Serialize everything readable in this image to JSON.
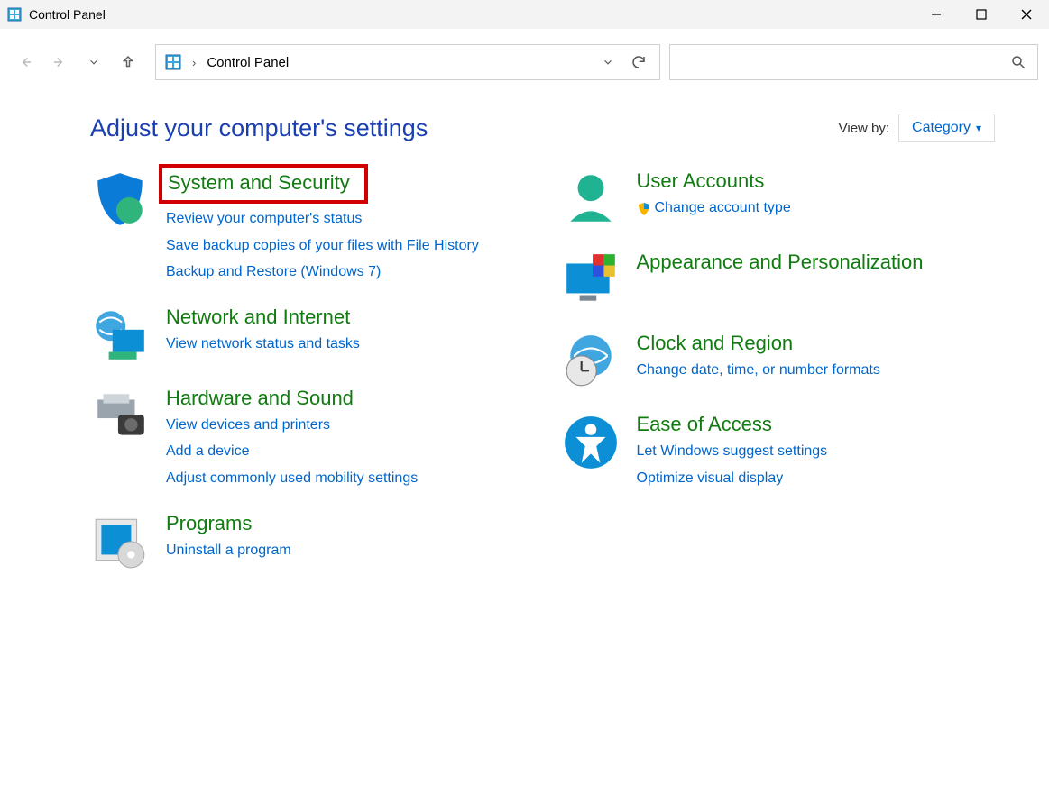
{
  "window": {
    "title": "Control Panel"
  },
  "breadcrumb": {
    "current": "Control Panel"
  },
  "header": {
    "heading": "Adjust your computer's settings",
    "viewby_label": "View by:",
    "viewby_value": "Category"
  },
  "left": [
    {
      "title": "System and Security",
      "highlighted": true,
      "links": [
        "Review your computer's status",
        "Save backup copies of your files with File History",
        "Backup and Restore (Windows 7)"
      ]
    },
    {
      "title": "Network and Internet",
      "links": [
        "View network status and tasks"
      ]
    },
    {
      "title": "Hardware and Sound",
      "links": [
        "View devices and printers",
        "Add a device",
        "Adjust commonly used mobility settings"
      ]
    },
    {
      "title": "Programs",
      "links": [
        "Uninstall a program"
      ]
    }
  ],
  "right": [
    {
      "title": "User Accounts",
      "links": [
        "Change account type"
      ],
      "shield_on_first": true
    },
    {
      "title": "Appearance and Personalization",
      "links": []
    },
    {
      "title": "Clock and Region",
      "links": [
        "Change date, time, or number formats"
      ]
    },
    {
      "title": "Ease of Access",
      "links": [
        "Let Windows suggest settings",
        "Optimize visual display"
      ]
    }
  ]
}
